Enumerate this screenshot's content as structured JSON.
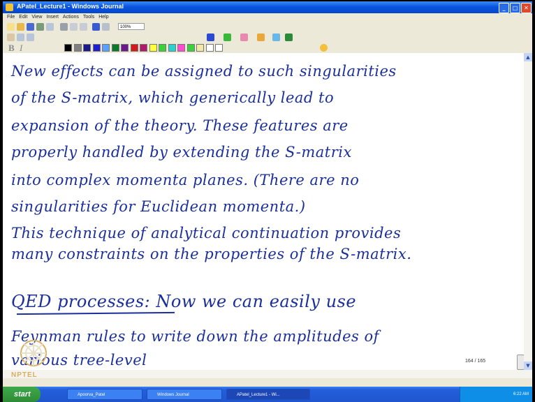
{
  "window": {
    "title": "APatel_Lecture1 - Windows Journal"
  },
  "menubar": [
    "File",
    "Edit",
    "View",
    "Insert",
    "Actions",
    "Tools",
    "Help"
  ],
  "toolbar": {
    "zoom": "100%"
  },
  "format": {
    "bold": "B",
    "italic": "I"
  },
  "palette": [
    "#000000",
    "#808080",
    "#1a1a8c",
    "#1f1fd1",
    "#5aa0ff",
    "#0a7a2a",
    "#6a1a8c",
    "#d11a1a",
    "#b01a6a",
    "#ffff3a",
    "#3ad13a",
    "#2ad1d1",
    "#ff4ad1",
    "#3ad13a",
    "#f2e8a8",
    "#ffffff",
    "#ffffff"
  ],
  "notes": {
    "lines": [
      "New effects can be assigned to such singularities",
      "of the S-matrix, which generically lead to",
      "expansion of the theory. These features are",
      "properly handled by extending the S-matrix",
      "into complex momenta planes. (There are no",
      "singularities for Euclidean momenta.)",
      "This technique of analytical continuation provides",
      "many constraints on the properties of the S-matrix.",
      "QED processes: Now we can easily use",
      "Feynman rules to write down the amplitudes of",
      "various tree-level"
    ]
  },
  "page_counter": "164 / 165",
  "watermark": "NPTEL",
  "taskbar": {
    "start": "start",
    "tasks": [
      "Apoorva_Patel",
      "Windows Journal",
      "APatel_Lecture1 - Wi..."
    ],
    "clock": "6:22 AM"
  }
}
